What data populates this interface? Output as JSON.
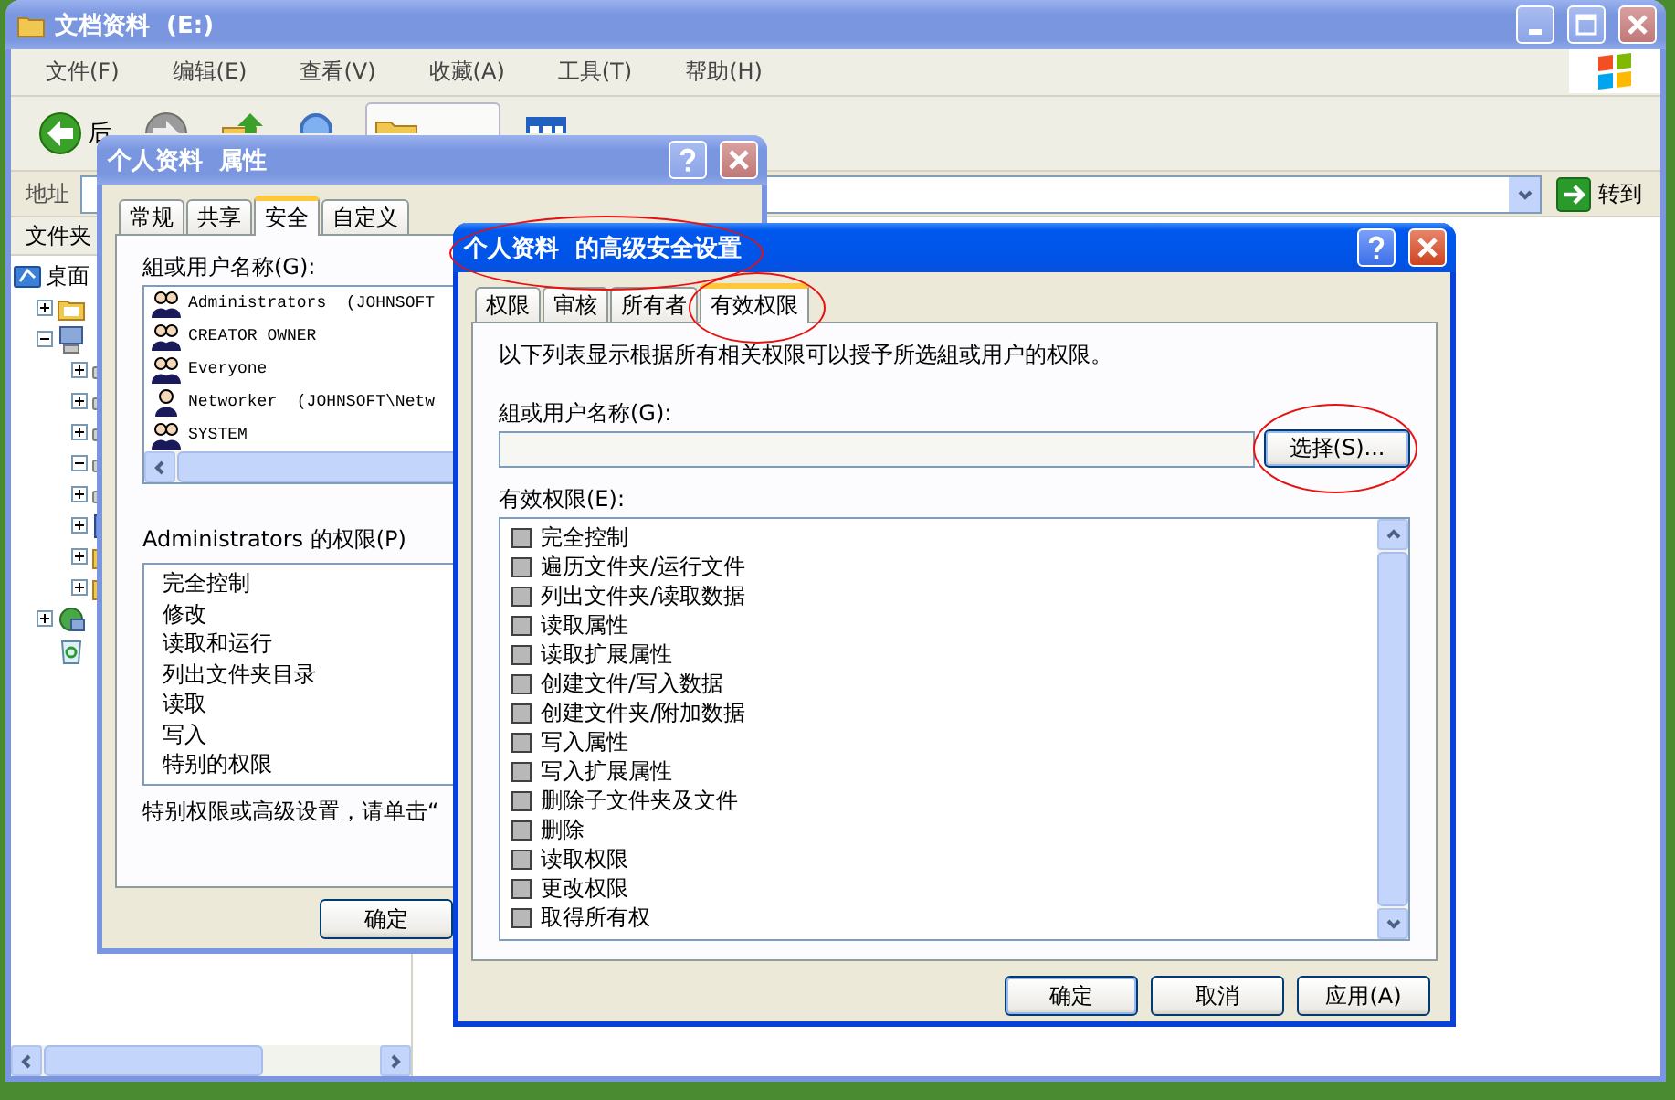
{
  "explorer": {
    "title": "文档资料  (E:)",
    "menu": [
      "文件(F)",
      "编辑(E)",
      "查看(V)",
      "收藏(A)",
      "工具(T)",
      "帮助(H)"
    ],
    "toolbar": [
      {
        "kind": "back",
        "label": "后",
        "selected": false
      },
      {
        "kind": "forward",
        "selected": false
      },
      {
        "kind": "up",
        "selected": false
      },
      {
        "kind": "search",
        "selected": false
      },
      {
        "kind": "folders",
        "selected": true
      },
      {
        "kind": "views",
        "selected": false
      }
    ],
    "address": {
      "label": "地址",
      "go": "转到"
    },
    "folder_pane": {
      "title": "文件夹",
      "tree": [
        {
          "kind": "desktop",
          "label": "桌面",
          "children": [
            {
              "kind": "documents",
              "expanded": false
            },
            {
              "kind": "computer",
              "expanded": true,
              "children": [
                {
                  "kind": "drive",
                  "expanded": false
                },
                {
                  "kind": "drive",
                  "expanded": false
                },
                {
                  "kind": "drive",
                  "expanded": false
                },
                {
                  "kind": "drive",
                  "expanded": true
                },
                {
                  "kind": "drive",
                  "expanded": false
                },
                {
                  "kind": "control",
                  "expanded": false
                },
                {
                  "kind": "folder",
                  "expanded": false
                },
                {
                  "kind": "folder",
                  "expanded": false
                }
              ]
            },
            {
              "kind": "network",
              "expanded": false
            },
            {
              "kind": "recycle"
            }
          ]
        }
      ]
    }
  },
  "properties": {
    "title": "个人资料  属性",
    "tabs": [
      {
        "label": "常规",
        "selected": false
      },
      {
        "label": "共享",
        "selected": false
      },
      {
        "label": "安全",
        "selected": true
      },
      {
        "label": "自定义",
        "selected": false
      }
    ],
    "group_label": "組或用户名称(G):",
    "users": [
      {
        "kind": "group",
        "name": "Administrators  (JOHNSOFT"
      },
      {
        "kind": "group",
        "name": "CREATOR OWNER"
      },
      {
        "kind": "group",
        "name": "Everyone"
      },
      {
        "kind": "user",
        "name": "Networker  (JOHNSOFT\\Netw"
      },
      {
        "kind": "group",
        "name": "SYSTEM"
      }
    ],
    "permissions_label": "Administrators 的权限(P)",
    "permissions": [
      "完全控制",
      "修改",
      "读取和运行",
      "列出文件夹目录",
      "读取",
      "写入",
      "特别的权限"
    ],
    "note": "特别权限或高级设置，请单击“",
    "buttons": [
      "确定"
    ]
  },
  "advanced": {
    "title": {
      "text": "个人资料  的高级安全设置",
      "circled": true
    },
    "tabs": [
      {
        "label": "权限",
        "selected": false,
        "circled": false
      },
      {
        "label": "审核",
        "selected": false,
        "circled": false
      },
      {
        "label": "所有者",
        "selected": false,
        "circled": false
      },
      {
        "label": "有效权限",
        "selected": true,
        "circled": true
      }
    ],
    "description": "以下列表显示根据所有相关权限可以授予所选組或用户的权限。",
    "group_label": "組或用户名称(G):",
    "select_button": {
      "label": "选择(S)...",
      "circled": true
    },
    "permissions_label": "有效权限(E):",
    "permissions": [
      {
        "label": "完全控制",
        "checked": false
      },
      {
        "label": "遍历文件夹/运行文件",
        "checked": false
      },
      {
        "label": "列出文件夹/读取数据",
        "checked": false
      },
      {
        "label": "读取属性",
        "checked": false
      },
      {
        "label": "读取扩展属性",
        "checked": false
      },
      {
        "label": "创建文件/写入数据",
        "checked": false
      },
      {
        "label": "创建文件夹/附加数据",
        "checked": false
      },
      {
        "label": "写入属性",
        "checked": false
      },
      {
        "label": "写入扩展属性",
        "checked": false
      },
      {
        "label": "删除子文件夹及文件",
        "checked": false
      },
      {
        "label": "删除",
        "checked": false
      },
      {
        "label": "读取权限",
        "checked": false
      },
      {
        "label": "更改权限",
        "checked": false
      },
      {
        "label": "取得所有权",
        "checked": false
      }
    ],
    "buttons": [
      "确定",
      "取消",
      "应用(A)"
    ]
  }
}
